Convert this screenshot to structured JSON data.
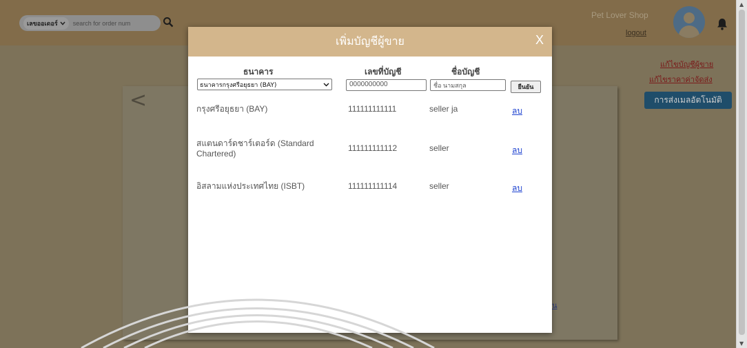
{
  "header": {
    "search_select_label": "เลขออเดอร์",
    "search_placeholder": "search for order num",
    "shop_name": "Pet Lover Shop",
    "logout_label": "logout"
  },
  "side_links": {
    "edit_seller_account": "แก้ไขบัญชีผู้ขาย",
    "edit_shipping_price": "แก้ไขราคาค่าจัดส่ง",
    "auto_email_button": "การส่งเมลอัตโนมัติ"
  },
  "background": {
    "prev_arrow": "<",
    "partial_link": "น"
  },
  "modal": {
    "title": "เพิ่มบัญชีผู้ขาย",
    "close_label": "X",
    "form": {
      "bank_header": "ธนาคาร",
      "account_number_header": "เลขที่บัญชี",
      "account_name_header": "ชื่อบัญชี",
      "bank_selected": "ธนาคารกรุงศรีอยุธยา (BAY)",
      "account_number_placeholder": "0000000000",
      "account_name_placeholder": "ชื่อ นามสกุล",
      "confirm_label": "ยืนยัน"
    },
    "accounts": [
      {
        "bank": "กรุงศรีอยุธยา (BAY)",
        "number": "111111111111",
        "name": "seller ja",
        "action": "ลบ"
      },
      {
        "bank": "สแตนดาร์ดชาร์เตอร์ด (Standard Chartered)",
        "number": "111111111112",
        "name": "seller",
        "action": "ลบ"
      },
      {
        "bank": "อิสลามแห่งประเทศไทย (ISBT)",
        "number": "111111111114",
        "name": "seller",
        "action": "ลบ"
      }
    ]
  }
}
